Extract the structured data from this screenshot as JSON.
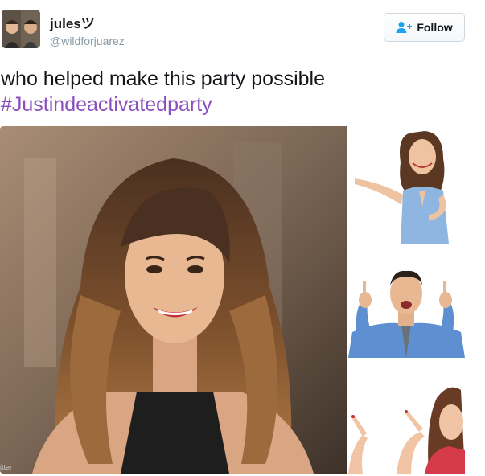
{
  "user": {
    "display_name": "julesツ",
    "handle": "@wildforjuarez",
    "avatar_icon": "profile-photo"
  },
  "follow_button": {
    "label": "Follow",
    "icon": "add-user-icon",
    "icon_color": "#1da1f2"
  },
  "tweet": {
    "text": "who helped make this party possible",
    "hashtag": "#Justindeactivatedparty",
    "hashtag_color": "#8a4fbd"
  },
  "media": {
    "main_image": "smiling-woman-photo",
    "side_images": [
      "woman-presenting-photo",
      "man-pointing-up-photo",
      "woman-pointing-photo"
    ],
    "credit": "itter"
  }
}
